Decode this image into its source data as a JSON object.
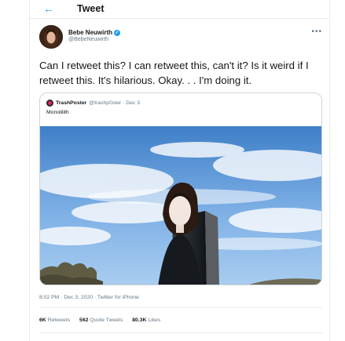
{
  "header": {
    "back_icon": "arrow-left-icon",
    "title": "Tweet"
  },
  "tweet": {
    "author_name": "Bebe Neuwirth",
    "author_handle": "@BebeNeuwirth",
    "text": "Can I retweet this? I can retweet this, can't it? Is it weird if I retweet this. It's hilarious. Okay. . . I'm doing it.",
    "timestamp": "8:02 PM · Dec 3, 2020 · Twitter for iPhone",
    "more_icon": "more-horizontal-icon"
  },
  "quote": {
    "name": "TrashPoster",
    "handle_date": "@trashp0ster · Dec 3",
    "text": "Monolilith"
  },
  "stats": {
    "retweets_count": "6K",
    "retweets_label": "Retweets",
    "quotes_count": "562",
    "quotes_label": "Quote Tweets",
    "likes_count": "80.3K",
    "likes_label": "Likes"
  },
  "colors": {
    "accent": "#1da1f2",
    "secondary_text": "#657786",
    "border": "#e6ecf0"
  }
}
